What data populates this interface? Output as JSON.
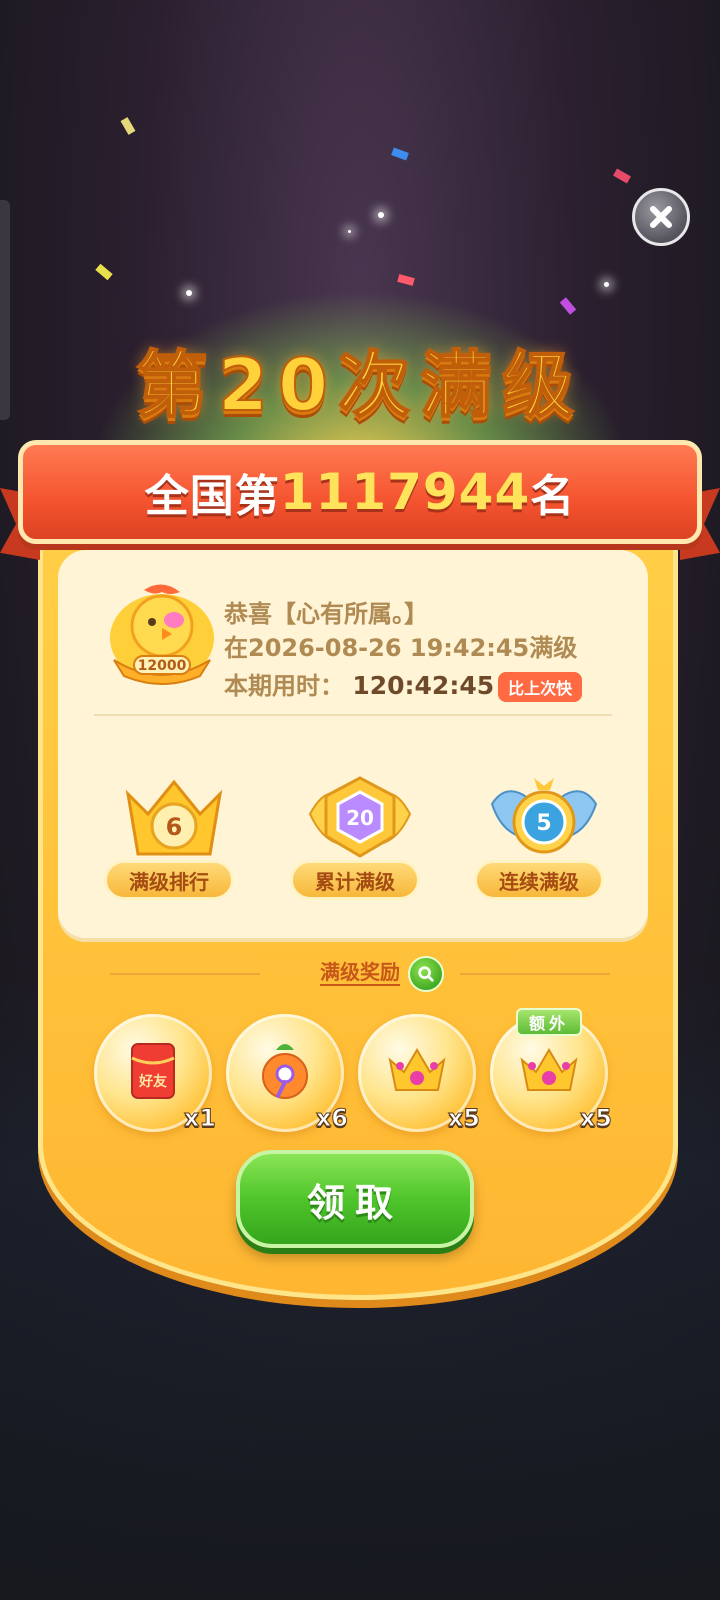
{
  "close": {
    "icon": "close-icon"
  },
  "title": "第20次满级",
  "ribbon": {
    "prefix": "全国第",
    "rank": "1117944",
    "suffix": "名"
  },
  "info": {
    "congrats": "恭喜【心有所属。】",
    "time_line": "在2026-08-26 19:42:45满级",
    "duration_label": "本期用时：",
    "duration_value": "120:42:45",
    "badge": "比上次快",
    "trophy_value": "12000"
  },
  "stats": [
    {
      "value": "6",
      "label": "满级排行",
      "icon": "crown-badge-icon"
    },
    {
      "value": "20",
      "label": "累计满级",
      "icon": "hexagon-medal-icon"
    },
    {
      "value": "5",
      "label": "连续满级",
      "icon": "winged-medal-icon"
    }
  ],
  "rewards": {
    "title": "满级奖励",
    "items": [
      {
        "icon": "red-packet-icon",
        "text": "好友",
        "qty": "x1"
      },
      {
        "icon": "magic-pot-icon",
        "qty": "x6"
      },
      {
        "icon": "crown-icon",
        "qty": "x5"
      },
      {
        "icon": "crown-icon",
        "qty": "x5",
        "tag": "额外"
      }
    ]
  },
  "claim_button": "领取",
  "colors": {
    "ribbon": "#f4532f",
    "panel": "#ffc43b",
    "claim": "#4fc52b",
    "title": "#ffd23c"
  }
}
